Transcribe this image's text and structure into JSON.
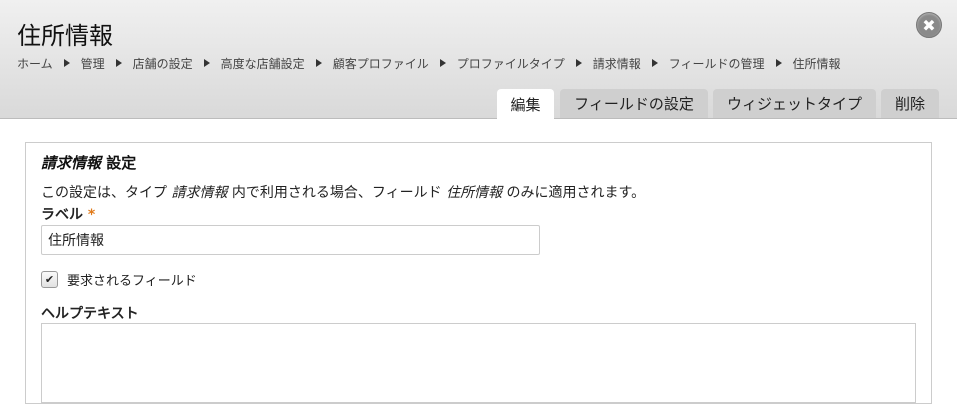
{
  "header": {
    "title": "住所情報",
    "close_glyph": "✖",
    "close_icon": "close-icon"
  },
  "breadcrumb": [
    "ホーム",
    "管理",
    "店舗の設定",
    "高度な店舗設定",
    "顧客プロファイル",
    "プロファイルタイプ",
    "請求情報",
    "フィールドの管理",
    "住所情報"
  ],
  "tabs": [
    {
      "label": "編集",
      "active": true
    },
    {
      "label": "フィールドの設定",
      "active": false
    },
    {
      "label": "ウィジェットタイプ",
      "active": false
    },
    {
      "label": "削除",
      "active": false
    }
  ],
  "form": {
    "legend_bundle": "請求情報",
    "legend_suffix": " 設定",
    "desc_part1": "この設定は、タイプ ",
    "desc_bundle": "請求情報",
    "desc_part2": " 内で利用される場合、フィールド ",
    "desc_field": "住所情報",
    "desc_part3": " のみに適用されます。",
    "label_title": "ラベル",
    "required_marker": "*",
    "label_value": "住所情報",
    "required_checkbox_label": "要求されるフィールド",
    "required_checked": true,
    "help_label": "ヘルプテキスト",
    "help_value": ""
  },
  "colors": {
    "required": "#e07a1a",
    "tab_inactive": "#cfcfcf",
    "tab_active": "#ffffff"
  }
}
